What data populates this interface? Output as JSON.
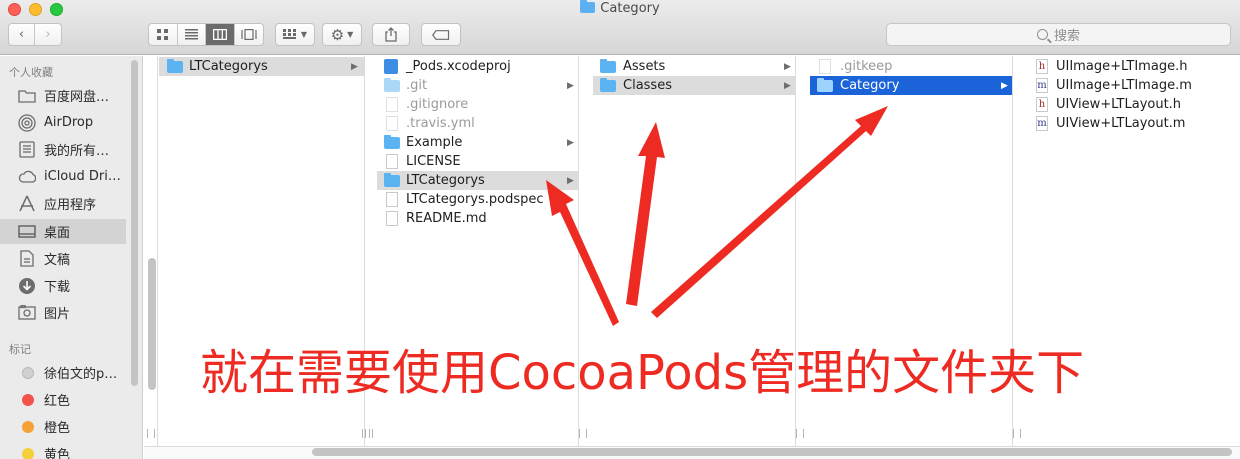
{
  "window": {
    "title": "Category"
  },
  "toolbar": {
    "search_placeholder": "搜索",
    "view_icons": [
      "icon-view-icon",
      "list-view-icon",
      "column-view-icon",
      "gallery-view-icon"
    ],
    "arrange_icon": "grid-arrange-icon",
    "action_icon": "gear-icon",
    "share_icon": "share-icon",
    "tag_icon": "tag-icon"
  },
  "sidebar": {
    "favorites_header": "个人收藏",
    "favorites": [
      {
        "label": "百度网盘…",
        "icon": "folder-icon"
      },
      {
        "label": "AirDrop",
        "icon": "airdrop-icon"
      },
      {
        "label": "我的所有…",
        "icon": "all-files-icon"
      },
      {
        "label": "iCloud Dri…",
        "icon": "cloud-icon"
      },
      {
        "label": "应用程序",
        "icon": "applications-icon"
      },
      {
        "label": "桌面",
        "icon": "desktop-icon",
        "selected": true
      },
      {
        "label": "文稿",
        "icon": "documents-icon"
      },
      {
        "label": "下载",
        "icon": "downloads-icon"
      },
      {
        "label": "图片",
        "icon": "pictures-icon"
      }
    ],
    "tags_header": "标记",
    "tags": [
      {
        "label": "徐伯文的p…",
        "color": "#d0d0d0"
      },
      {
        "label": "红色",
        "color": "#f2524a"
      },
      {
        "label": "橙色",
        "color": "#f6a137"
      },
      {
        "label": "黄色",
        "color": "#f5cf3a"
      }
    ]
  },
  "columns": {
    "col1": [
      {
        "label": "LTCategorys",
        "kind": "folder",
        "state": "grey",
        "chevron": true
      }
    ],
    "col2": [
      {
        "label": "_Pods.xcodeproj",
        "kind": "proj"
      },
      {
        "label": ".git",
        "kind": "folder",
        "dim": true,
        "chevron": true
      },
      {
        "label": ".gitignore",
        "kind": "doc",
        "dim": true
      },
      {
        "label": ".travis.yml",
        "kind": "doc",
        "dim": true
      },
      {
        "label": "Example",
        "kind": "folder",
        "chevron": true
      },
      {
        "label": "LICENSE",
        "kind": "doc"
      },
      {
        "label": "LTCategorys",
        "kind": "folder",
        "state": "grey",
        "chevron": true
      },
      {
        "label": "LTCategorys.podspec",
        "kind": "doc"
      },
      {
        "label": "README.md",
        "kind": "doc"
      }
    ],
    "col3": [
      {
        "label": "Assets",
        "kind": "folder",
        "chevron": true
      },
      {
        "label": "Classes",
        "kind": "folder",
        "state": "grey",
        "chevron": true
      }
    ],
    "col4": [
      {
        "label": ".gitkeep",
        "kind": "doc",
        "dim": true
      },
      {
        "label": "Category",
        "kind": "folder",
        "state": "blue",
        "chevron": true
      }
    ],
    "col5": [
      {
        "label": "UIImage+LTImage.h",
        "kind": "h"
      },
      {
        "label": "UIImage+LTImage.m",
        "kind": "m"
      },
      {
        "label": "UIView+LTLayout.h",
        "kind": "h"
      },
      {
        "label": "UIView+LTLayout.m",
        "kind": "m"
      }
    ]
  },
  "annotation": {
    "caption": "就在需要使用CocoaPods管理的文件夹下",
    "color": "#ee2b22"
  }
}
